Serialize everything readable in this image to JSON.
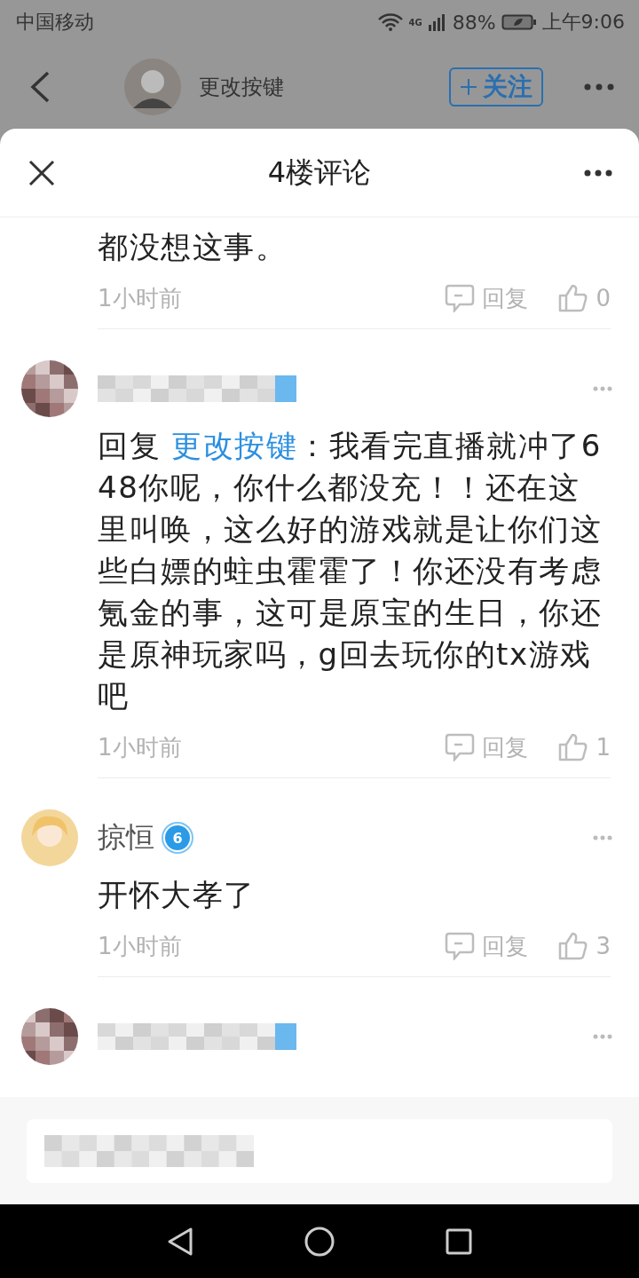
{
  "status_bar": {
    "carrier": "中国移动",
    "network": "4G",
    "battery": "88%",
    "time": "上午9:06"
  },
  "post_header": {
    "author": "更改按键",
    "follow_label": "关注",
    "following": false
  },
  "sheet": {
    "title": "4楼评论"
  },
  "comments": [
    {
      "kind": "text_only",
      "text": "都没想这事。",
      "time": "1小时前",
      "reply_label": "回复",
      "likes": "0"
    },
    {
      "kind": "full",
      "author_blurred": true,
      "reply_prefix": "回复",
      "reply_to": "更改按键",
      "text": "：我看完直播就冲了648你呢，你什么都没充！！还在这里叫唤，这么好的游戏就是让你们这些白嫖的蛀虫霍霍了！你还没有考虑氪金的事，这可是原宝的生日，你还是原神玩家吗，g回去玩你的tx游戏吧",
      "time": "1小时前",
      "reply_label": "回复",
      "likes": "1"
    },
    {
      "kind": "full",
      "author_blurred": false,
      "author": "掠恒",
      "level": "6",
      "text": "开怀大孝了",
      "time": "1小时前",
      "reply_label": "回复",
      "likes": "3"
    },
    {
      "kind": "header_only",
      "author_blurred": true
    }
  ],
  "composer": {
    "placeholder_blurred": true
  }
}
